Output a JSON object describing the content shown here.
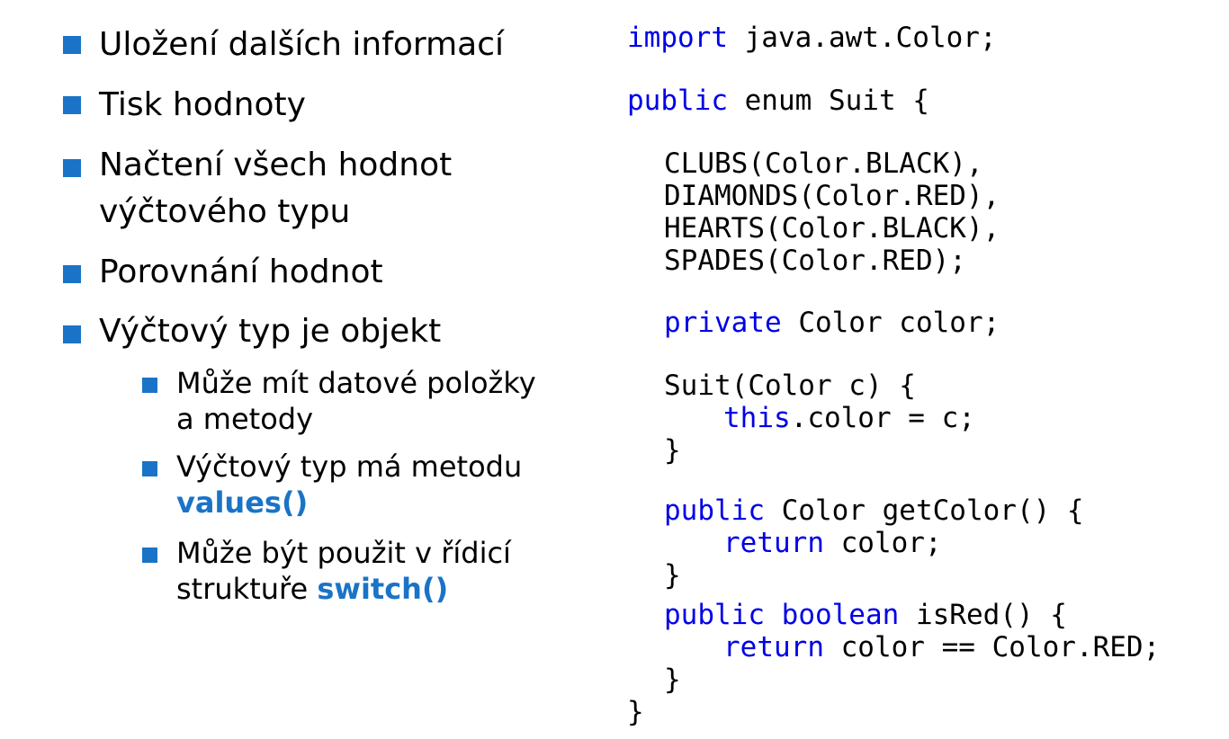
{
  "bullets": [
    {
      "text": "Uložení dalších informací"
    },
    {
      "text": "Tisk hodnoty"
    },
    {
      "lines": [
        "Načtení všech hodnot",
        "výčtového typu"
      ]
    },
    {
      "text": "Porovnání hodnot"
    },
    {
      "text": "Výčtový typ je objekt"
    }
  ],
  "sub_bullets": [
    {
      "lines": [
        "Může mít datové položky",
        "a metody"
      ]
    },
    {
      "line1": "Výčtový typ má metodu",
      "highlight": "values()"
    },
    {
      "line1": "Může být použit v řídicí",
      "line2_prefix": "struktuře ",
      "highlight": "switch()"
    }
  ],
  "code": {
    "l1_kw": "import",
    "l1_rest": " java.awt.Color;",
    "l2_kw": "public",
    "l2_rest": " enum Suit {",
    "l3": "CLUBS(Color.BLACK),",
    "l4": "DIAMONDS(Color.RED),",
    "l5": "HEARTS(Color.BLACK),",
    "l6": "SPADES(Color.RED);",
    "l7_kw": "private",
    "l7_rest": " Color color;",
    "l8": "Suit(Color c) {",
    "l9_kw": "this",
    "l9_rest": ".color = c;",
    "l10": "}",
    "l11_kw": "public",
    "l11_rest": " Color getColor() {",
    "l12_kw": "return",
    "l12_rest": " color;",
    "l13": "}",
    "l14_kw1": "public",
    "l14_kw2": "boolean",
    "l14_rest": " isRed() {",
    "l15_kw": "return",
    "l15_rest": " color == Color.RED;",
    "l16": "}",
    "l17": "}"
  },
  "colors": {
    "bullet_accent": "#1a73c7",
    "code_keyword": "#0000e6"
  }
}
